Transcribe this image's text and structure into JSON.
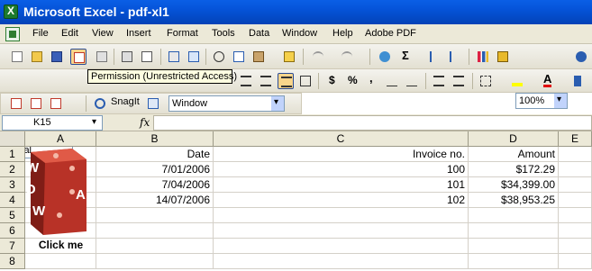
{
  "window": {
    "title": "Microsoft Excel - pdf-xl1"
  },
  "menu": [
    "File",
    "Edit",
    "View",
    "Insert",
    "Format",
    "Tools",
    "Data",
    "Window",
    "Help",
    "Adobe PDF"
  ],
  "toolbar": {
    "zoom": "100%",
    "tooltip": "Permission (Unrestricted Access)",
    "font": "Arial",
    "currency_symbol": "$",
    "percent_symbol": "%",
    "font_color_label": "A"
  },
  "snagit": {
    "label": "SnagIt",
    "capture_mode": "Window"
  },
  "formula_bar": {
    "name_box": "K15",
    "fx_label": "fx",
    "formula": ""
  },
  "grid": {
    "columns": [
      "A",
      "B",
      "C",
      "D",
      "E"
    ],
    "rows": [
      "1",
      "2",
      "3",
      "4",
      "5",
      "6",
      "7",
      "8"
    ],
    "headers": {
      "date": "Date",
      "invoice": "Invoice no.",
      "amount": "Amount"
    },
    "records": [
      {
        "date": "7/01/2006",
        "invoice": "100",
        "amount": "$172.29"
      },
      {
        "date": "7/04/2006",
        "invoice": "101",
        "amount": "$34,399.00"
      },
      {
        "date": "14/07/2006",
        "invoice": "102",
        "amount": "$38,953.25"
      }
    ]
  },
  "logo": {
    "letters": [
      "W",
      "O",
      "W",
      "A"
    ]
  },
  "button": {
    "click_me": "Click me"
  },
  "colors": {
    "titlebar": "#0553d8",
    "logo_red": "#c0392b",
    "chrome": "#ece9d8"
  }
}
